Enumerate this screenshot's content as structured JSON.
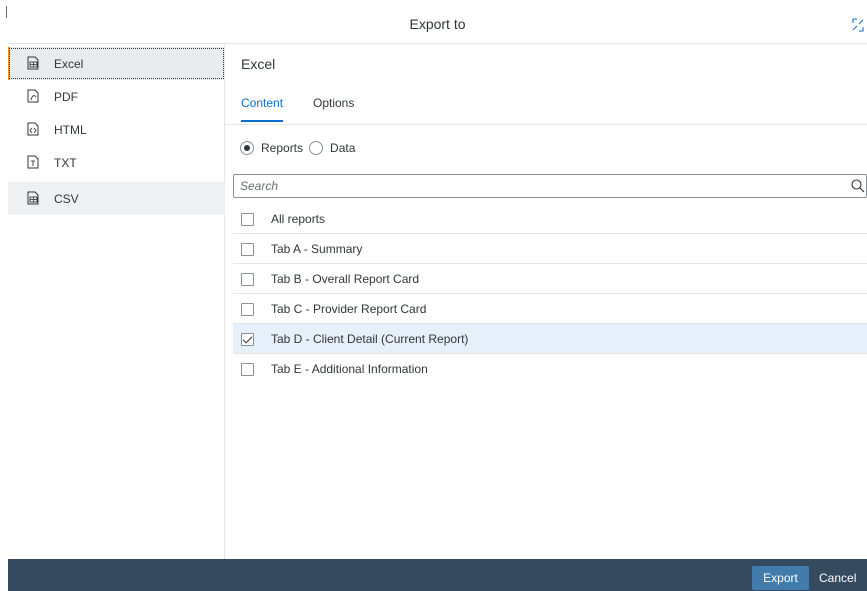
{
  "dialog": {
    "title": "Export to"
  },
  "sidebar": {
    "items": [
      {
        "label": "Excel",
        "icon": "excel-icon"
      },
      {
        "label": "PDF",
        "icon": "pdf-icon"
      },
      {
        "label": "HTML",
        "icon": "html-icon"
      },
      {
        "label": "TXT",
        "icon": "txt-icon"
      },
      {
        "label": "CSV",
        "icon": "csv-icon"
      }
    ],
    "selected": "Excel"
  },
  "main": {
    "section_title": "Excel",
    "tabs": [
      {
        "label": "Content",
        "active": true
      },
      {
        "label": "Options",
        "active": false
      }
    ],
    "radios": [
      {
        "label": "Reports",
        "checked": true
      },
      {
        "label": "Data",
        "checked": false
      }
    ],
    "search": {
      "placeholder": "Search",
      "value": ""
    },
    "reports": [
      {
        "label": "All reports",
        "checked": false
      },
      {
        "label": "Tab A - Summary",
        "checked": false
      },
      {
        "label": "Tab B - Overall Report Card",
        "checked": false
      },
      {
        "label": "Tab C - Provider Report Card",
        "checked": false
      },
      {
        "label": "Tab D - Client Detail (Current Report)",
        "checked": true
      },
      {
        "label": "Tab E - Additional Information",
        "checked": false
      }
    ]
  },
  "footer": {
    "export_label": "Export",
    "cancel_label": "Cancel"
  },
  "colors": {
    "accent": "#0a6ed1",
    "footer_bg": "#354a5f",
    "primary_button": "#427cac",
    "selection_marker": "#e39a17"
  }
}
